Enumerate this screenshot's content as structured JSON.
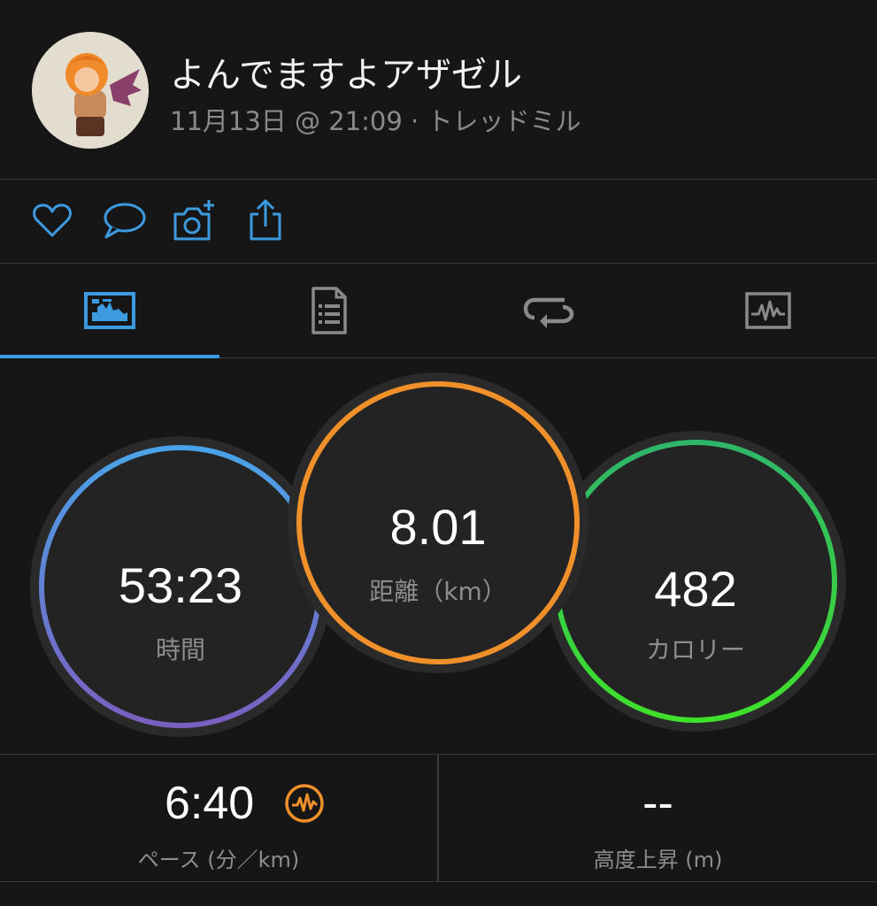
{
  "header": {
    "user_name": "よんでますよアザゼル",
    "activity_meta": "11月13日 @ 21:09 · トレッドミル"
  },
  "actions": [
    {
      "name": "like",
      "icon": "heart-icon"
    },
    {
      "name": "comment",
      "icon": "comment-icon"
    },
    {
      "name": "add-photo",
      "icon": "camera-plus-icon"
    },
    {
      "name": "share",
      "icon": "share-icon"
    }
  ],
  "tabs": [
    {
      "name": "overview",
      "icon": "overview-chart-icon",
      "active": true
    },
    {
      "name": "details",
      "icon": "document-list-icon",
      "active": false
    },
    {
      "name": "laps",
      "icon": "laps-loop-icon",
      "active": false
    },
    {
      "name": "charts",
      "icon": "heart-rate-chart-icon",
      "active": false
    }
  ],
  "stats": {
    "time": {
      "value": "53:23",
      "label": "時間"
    },
    "distance": {
      "value": "8.01",
      "label": "距離（km）"
    },
    "calories": {
      "value": "482",
      "label": "カロリー"
    }
  },
  "bottom": {
    "pace": {
      "value": "6:40",
      "label": "ペース (分／km)"
    },
    "elevation": {
      "value": "--",
      "label": "高度上昇 (m)"
    }
  },
  "colors": {
    "accent_blue": "#3c9be0",
    "time_ring_top": "#4aa3e8",
    "time_ring_bottom": "#7a5fc0",
    "distance_ring": "#f0902a",
    "calories_ring_top": "#2fb56a",
    "calories_ring_bottom": "#3fe02a",
    "pace_icon": "#f0902a"
  }
}
